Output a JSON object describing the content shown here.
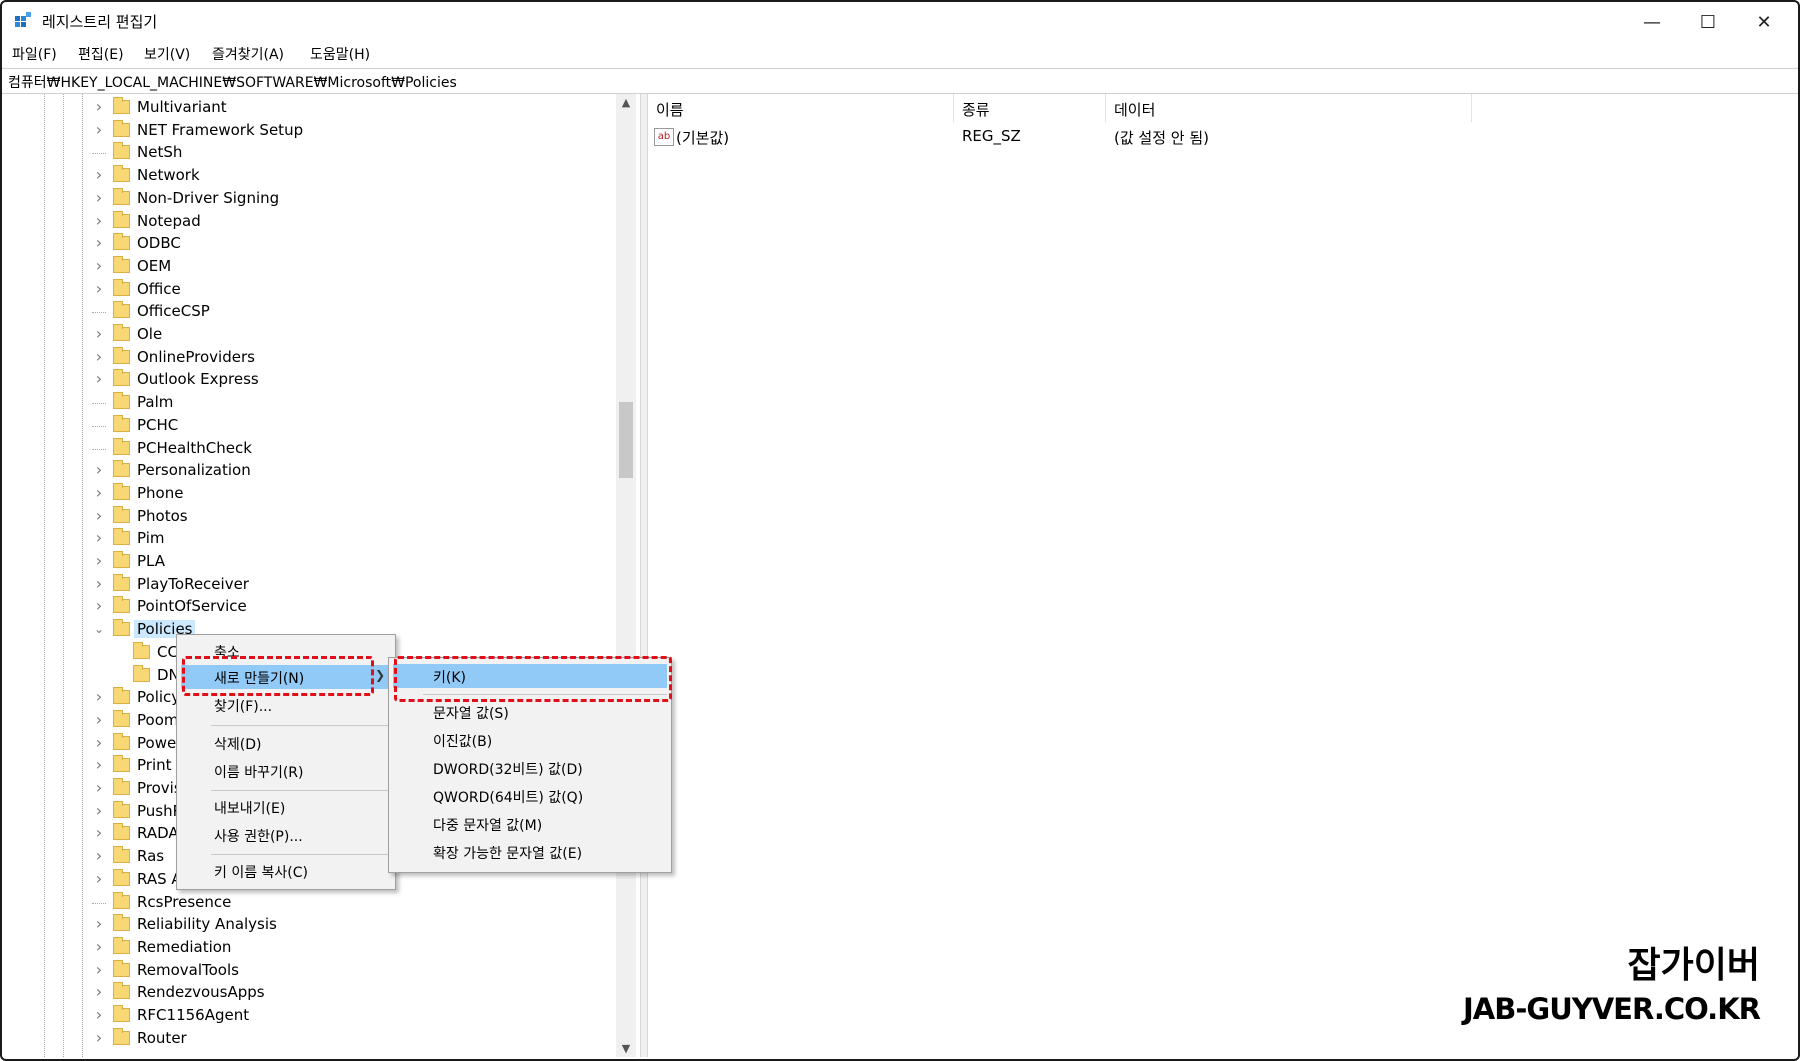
{
  "window": {
    "title": "레지스트리 편집기",
    "controls": {
      "minimize": "—",
      "maximize": "☐",
      "close": "✕"
    }
  },
  "menu": [
    "파일(F)",
    "편집(E)",
    "보기(V)",
    "즐겨찾기(A)",
    "도움말(H)"
  ],
  "address": "컴퓨터₩HKEY_LOCAL_MACHINE₩SOFTWARE₩Microsoft₩Policies",
  "tree": {
    "items": [
      {
        "label": "Multivariant",
        "expander": true
      },
      {
        "label": "NET Framework Setup",
        "expander": true
      },
      {
        "label": "NetSh",
        "expander": false
      },
      {
        "label": "Network",
        "expander": true
      },
      {
        "label": "Non-Driver Signing",
        "expander": true
      },
      {
        "label": "Notepad",
        "expander": true
      },
      {
        "label": "ODBC",
        "expander": true
      },
      {
        "label": "OEM",
        "expander": true
      },
      {
        "label": "Office",
        "expander": true
      },
      {
        "label": "OfficeCSP",
        "expander": false
      },
      {
        "label": "Ole",
        "expander": true
      },
      {
        "label": "OnlineProviders",
        "expander": true
      },
      {
        "label": "Outlook Express",
        "expander": true
      },
      {
        "label": "Palm",
        "expander": false
      },
      {
        "label": "PCHC",
        "expander": false
      },
      {
        "label": "PCHealthCheck",
        "expander": false
      },
      {
        "label": "Personalization",
        "expander": true
      },
      {
        "label": "Phone",
        "expander": true
      },
      {
        "label": "Photos",
        "expander": true
      },
      {
        "label": "Pim",
        "expander": true
      },
      {
        "label": "PLA",
        "expander": true
      },
      {
        "label": "PlayToReceiver",
        "expander": true
      },
      {
        "label": "PointOfService",
        "expander": true
      },
      {
        "label": "Policies",
        "expander": "open",
        "selected": true
      },
      {
        "label": "CC",
        "child": true
      },
      {
        "label": "DN",
        "child": true
      },
      {
        "label": "Policy",
        "expander": true
      },
      {
        "label": "Poom",
        "expander": true
      },
      {
        "label": "Powe",
        "expander": true
      },
      {
        "label": "Print",
        "expander": true
      },
      {
        "label": "Provis",
        "expander": true
      },
      {
        "label": "PushR",
        "expander": true
      },
      {
        "label": "RADA",
        "expander": true
      },
      {
        "label": "Ras",
        "expander": true
      },
      {
        "label": "RAS A",
        "expander": true
      },
      {
        "label": "RcsPresence",
        "expander": false
      },
      {
        "label": "Reliability Analysis",
        "expander": true
      },
      {
        "label": "Remediation",
        "expander": true
      },
      {
        "label": "RemovalTools",
        "expander": true
      },
      {
        "label": "RendezvousApps",
        "expander": true
      },
      {
        "label": "RFC1156Agent",
        "expander": true
      },
      {
        "label": "Router",
        "expander": true
      }
    ]
  },
  "list": {
    "columns": [
      "이름",
      "종류",
      "데이터"
    ],
    "rows": [
      {
        "icon": "ab",
        "name": "(기본값)",
        "type": "REG_SZ",
        "data": "(값 설정 안 됨)"
      }
    ]
  },
  "context_menu": {
    "items": [
      {
        "label": "축소"
      },
      {
        "label": "새로 만들기(N)",
        "highlight": true,
        "submenu": true
      },
      {
        "label": "찾기(F)..."
      },
      {
        "label": "삭제(D)"
      },
      {
        "label": "이름 바꾸기(R)"
      },
      {
        "label": "내보내기(E)"
      },
      {
        "label": "사용 권한(P)..."
      },
      {
        "label": "키 이름 복사(C)"
      }
    ]
  },
  "submenu": {
    "items": [
      {
        "label": "키(K)",
        "highlight": true
      },
      {
        "label": "문자열 값(S)"
      },
      {
        "label": "이진값(B)"
      },
      {
        "label": "DWORD(32비트) 값(D)"
      },
      {
        "label": "QWORD(64비트) 값(Q)"
      },
      {
        "label": "다중 문자열 값(M)"
      },
      {
        "label": "확장 가능한 문자열 값(E)"
      }
    ]
  },
  "watermark": {
    "line1": "잡가이버",
    "line2": "JAB-GUYVER.CO.KR"
  },
  "colors": {
    "highlight": "#91c9f7",
    "annotation": "#e0101a",
    "folder": "#f8d775"
  }
}
